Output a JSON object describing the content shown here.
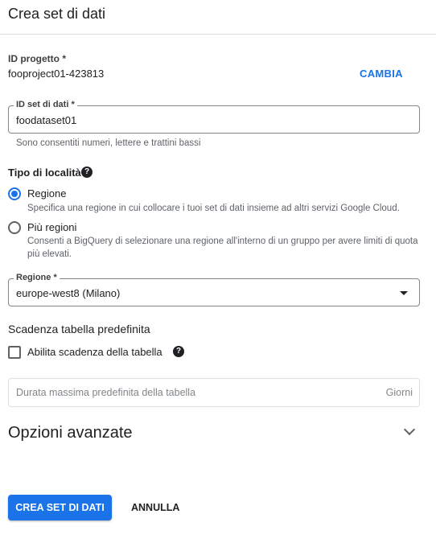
{
  "dialog": {
    "title": "Crea set di dati"
  },
  "project": {
    "label": "ID progetto *",
    "value": "fooproject01-423813",
    "change_label": "CAMBIA"
  },
  "dataset_id": {
    "label": "ID set di dati *",
    "value": "foodataset01",
    "hint": "Sono consentiti numeri, lettere e trattini bassi"
  },
  "location": {
    "title": "Tipo di località",
    "help_icon": "help-circle-icon",
    "options": [
      {
        "label": "Regione",
        "description": "Specifica una regione in cui collocare i tuoi set di dati insieme ad altri servizi Google Cloud.",
        "selected": true
      },
      {
        "label": "Più regioni",
        "description": "Consenti a BigQuery di selezionare una regione all'interno di un gruppo per avere limiti di quota più elevati.",
        "selected": false
      }
    ]
  },
  "region": {
    "label": "Regione *",
    "value": "europe-west8 (Milano)"
  },
  "expiration": {
    "title": "Scadenza tabella predefinita",
    "checkbox_label": "Abilita scadenza della tabella",
    "checked": false,
    "duration_placeholder": "Durata massima predefinita della tabella",
    "duration_unit": "Giorni"
  },
  "advanced": {
    "title": "Opzioni avanzate"
  },
  "actions": {
    "create_label": "CREA SET DI DATI",
    "cancel_label": "ANNULLA"
  },
  "colors": {
    "accent": "#1a73e8",
    "text": "#202124",
    "muted": "#5f6368"
  }
}
